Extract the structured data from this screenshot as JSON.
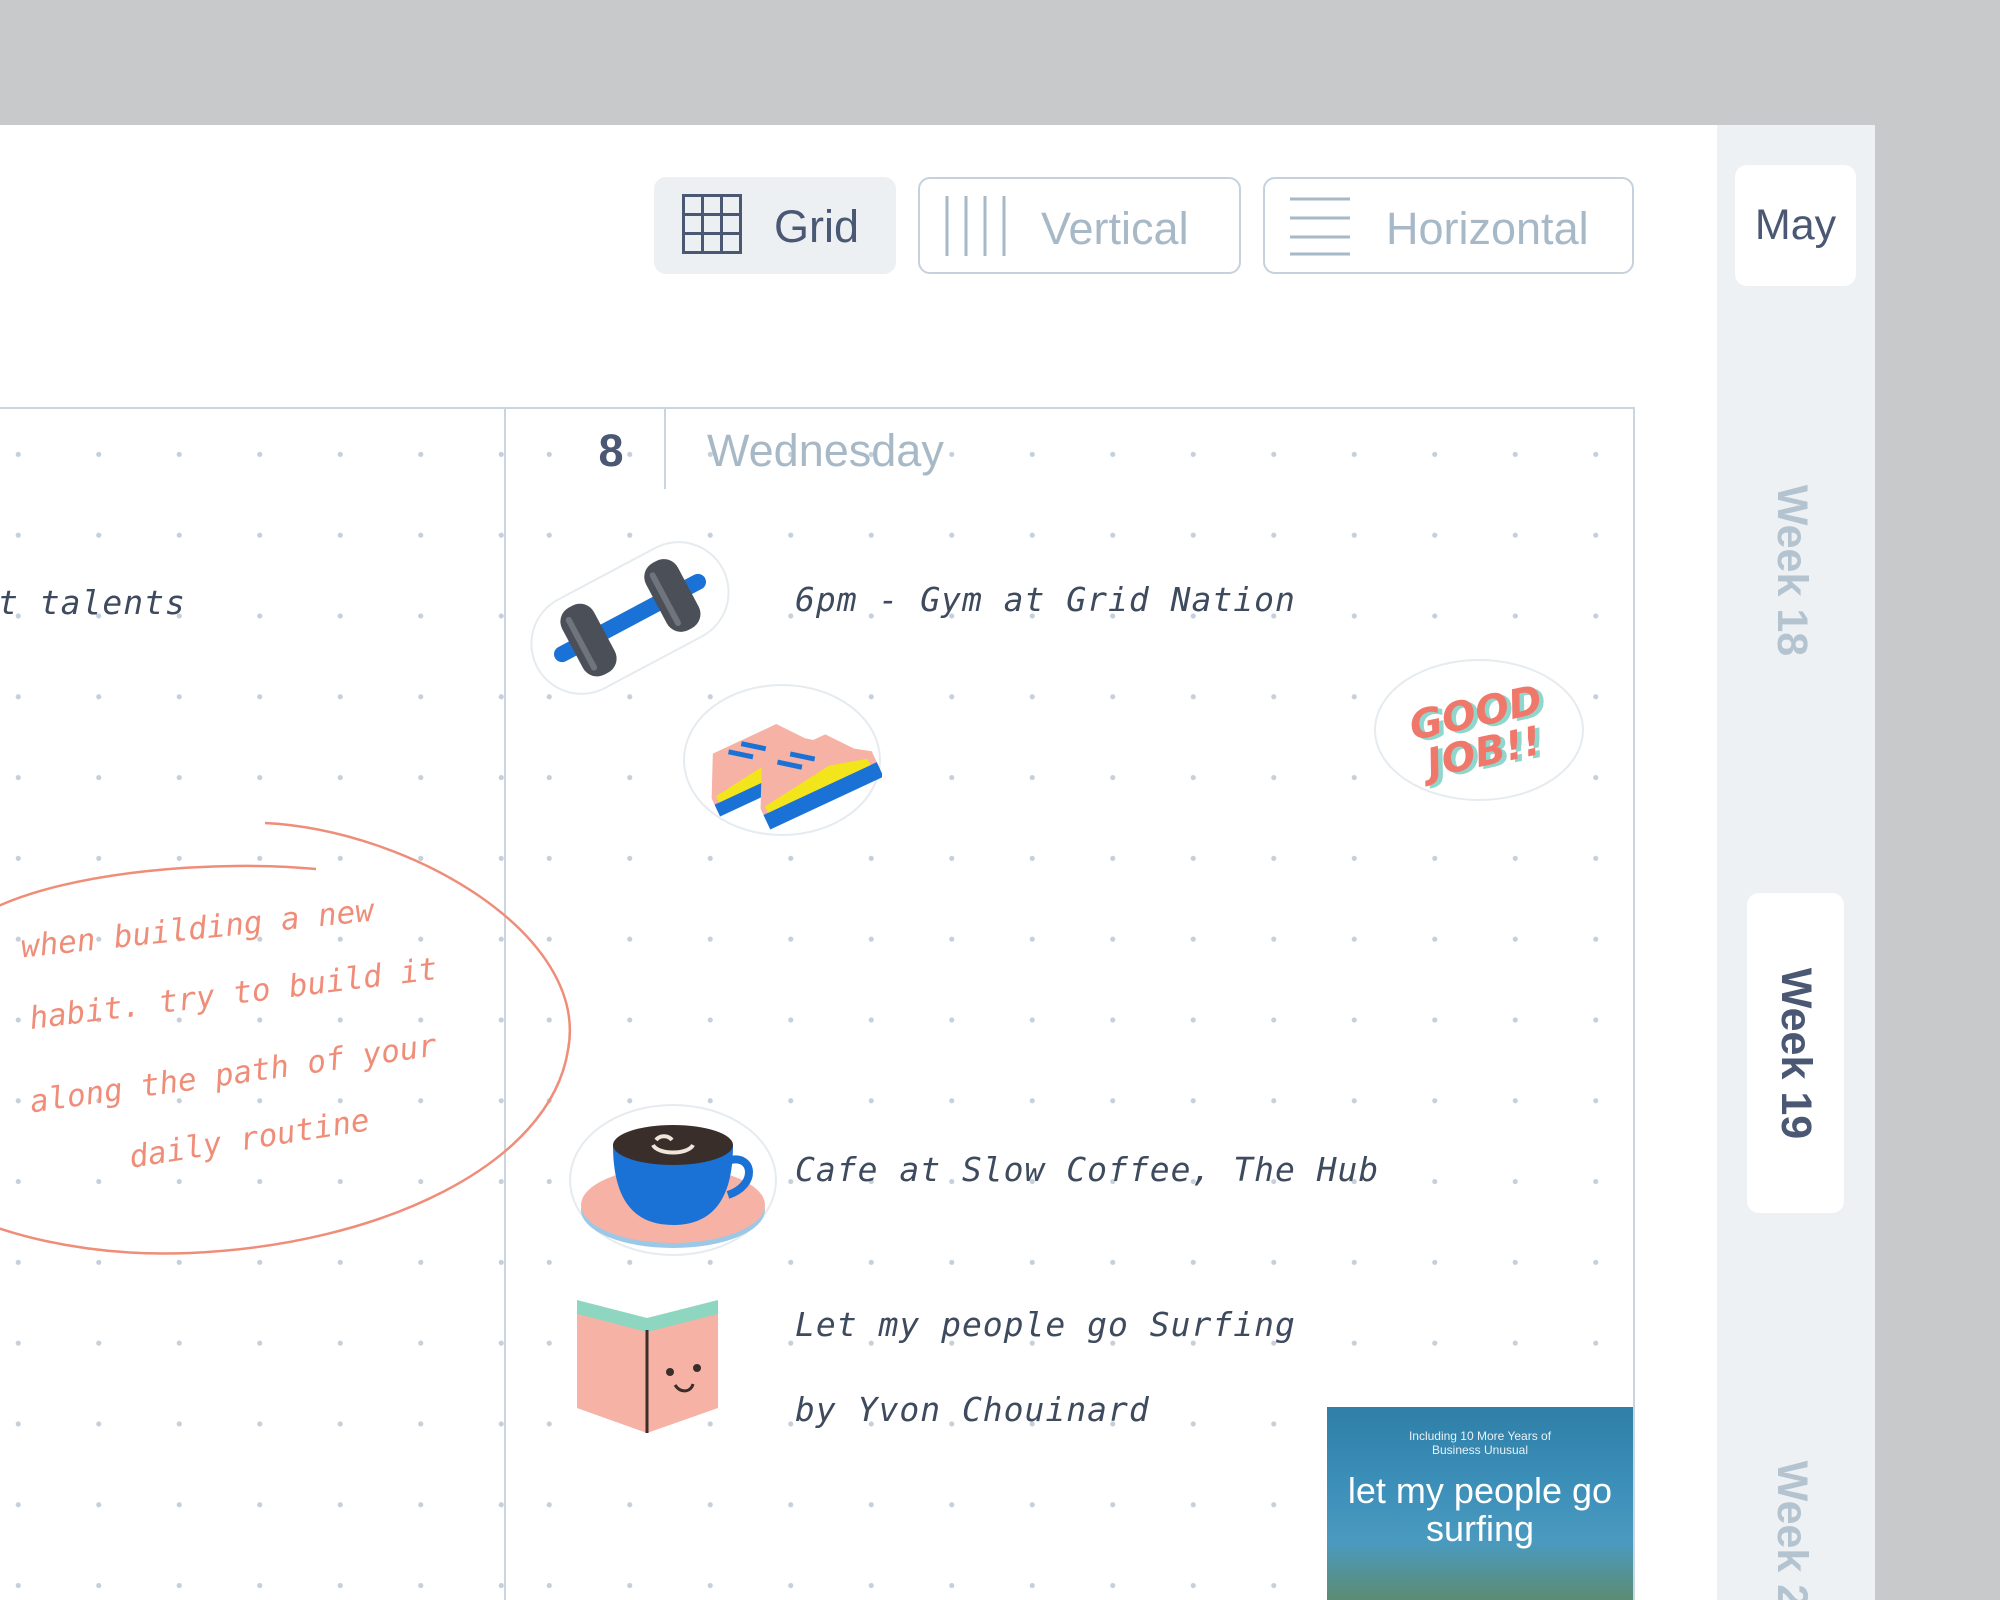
{
  "view_toggle": {
    "grid_label": "Grid",
    "vertical_label": "Vertical",
    "horizontal_label": "Horizontal",
    "active": "Grid"
  },
  "day": {
    "number": "8",
    "name": "Wednesday"
  },
  "left_column": {
    "fragment_text": "t talents",
    "handwritten_note": [
      "when building a new",
      "habit. try to build it",
      "along the path of your",
      "daily routine"
    ]
  },
  "entries": {
    "gym": "6pm - Gym at Grid Nation",
    "cafe": "Cafe at Slow Coffee, The Hub",
    "book_line1": "Let my people go Surfing",
    "book_line2": "by Yvon Chouinard"
  },
  "stickers": {
    "good_job": "GOOD JOB!!",
    "icons": [
      "dumbbell-icon",
      "sneakers-icon",
      "coffee-cup-icon",
      "book-face-icon"
    ]
  },
  "book_cover": {
    "subtitle": "Including 10 More Years of Business Unusual",
    "title": "let my people go surfing"
  },
  "sidebar": {
    "month": "May",
    "weeks": [
      "Week 18",
      "Week 19",
      "Week 2"
    ],
    "active_week": "Week 19"
  },
  "colors": {
    "accent_text": "#4a5874",
    "muted_text": "#a7b9c7",
    "note_coral": "#ef8d79",
    "border": "#c9d6e2"
  }
}
